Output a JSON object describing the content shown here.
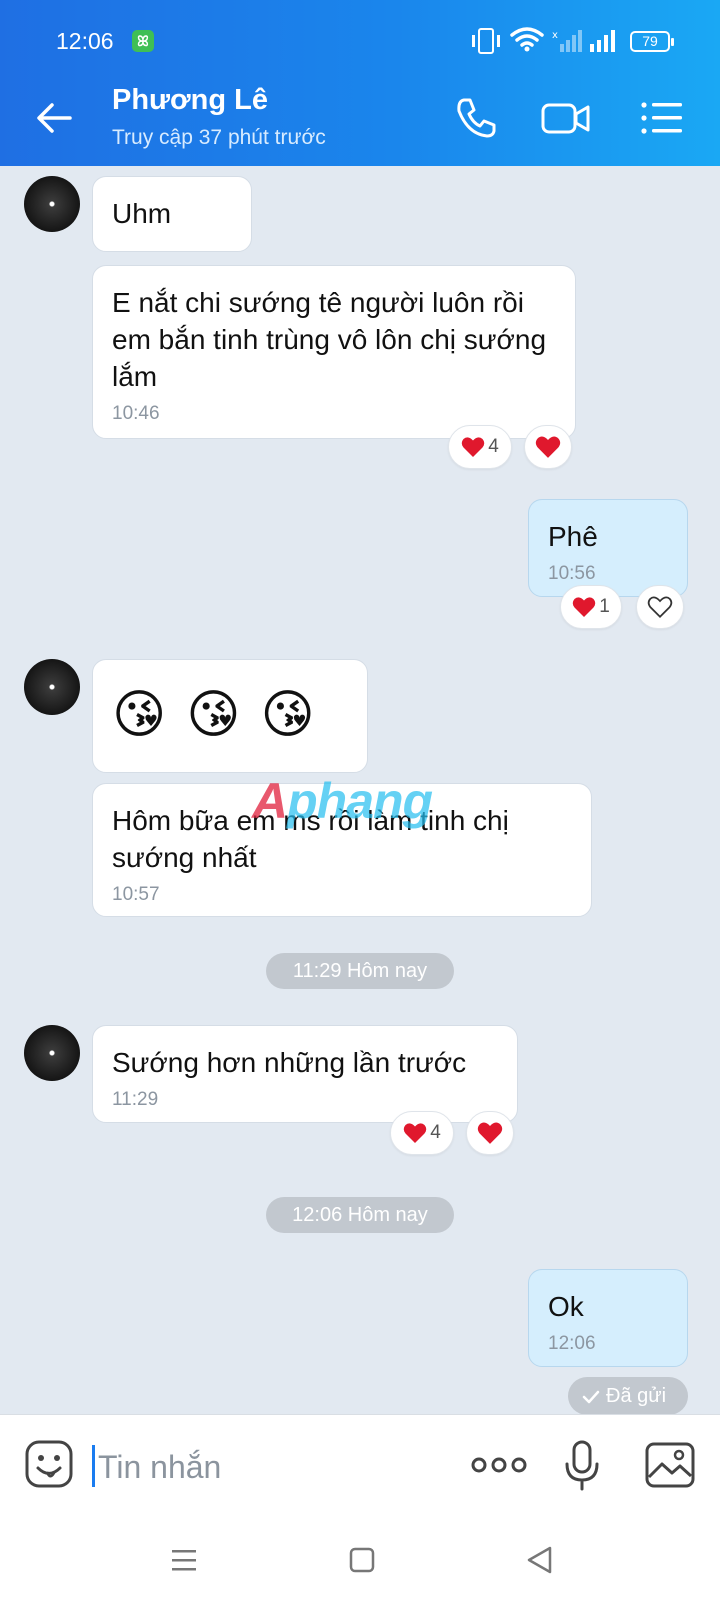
{
  "status_bar": {
    "time": "12:06",
    "app_badge": "ꕤ",
    "battery": "79"
  },
  "header": {
    "name": "Phương Lê",
    "status": "Truy cập 37 phút trước"
  },
  "messages": [
    {
      "text": "Uhm"
    },
    {
      "text": "E nắt chi sướng tê người luôn rồi em bắn tinh trùng vô lôn chị sướng lắm",
      "time": "10:46",
      "reaction_count": "4"
    },
    {
      "text": "Phê",
      "time": "10:56",
      "reaction_count": "1"
    },
    {
      "emoji": [
        "😘",
        "😘",
        "😘"
      ]
    },
    {
      "text": "Hôm bữa em ms rồi làm tinh chị sướng nhất",
      "time": "10:57"
    },
    {
      "text": "Sướng hơn những lần trước",
      "time": "11:29",
      "reaction_count": "4"
    },
    {
      "text": "Ok",
      "time": "12:06"
    }
  ],
  "date_separators": [
    "11:29 Hôm nay",
    "12:06 Hôm nay"
  ],
  "sent_status": "Đã gửi",
  "watermark": {
    "part1": "A",
    "part2": "phang"
  },
  "composer": {
    "placeholder": "Tin nhắn"
  },
  "colors": {
    "header_start": "#1f6fe3",
    "header_end": "#1aa8f4",
    "chat_bg": "#e2e9f1",
    "my_bubble": "#d5eefd",
    "heart": "#e0182d",
    "accent": "#1a7cf0"
  }
}
